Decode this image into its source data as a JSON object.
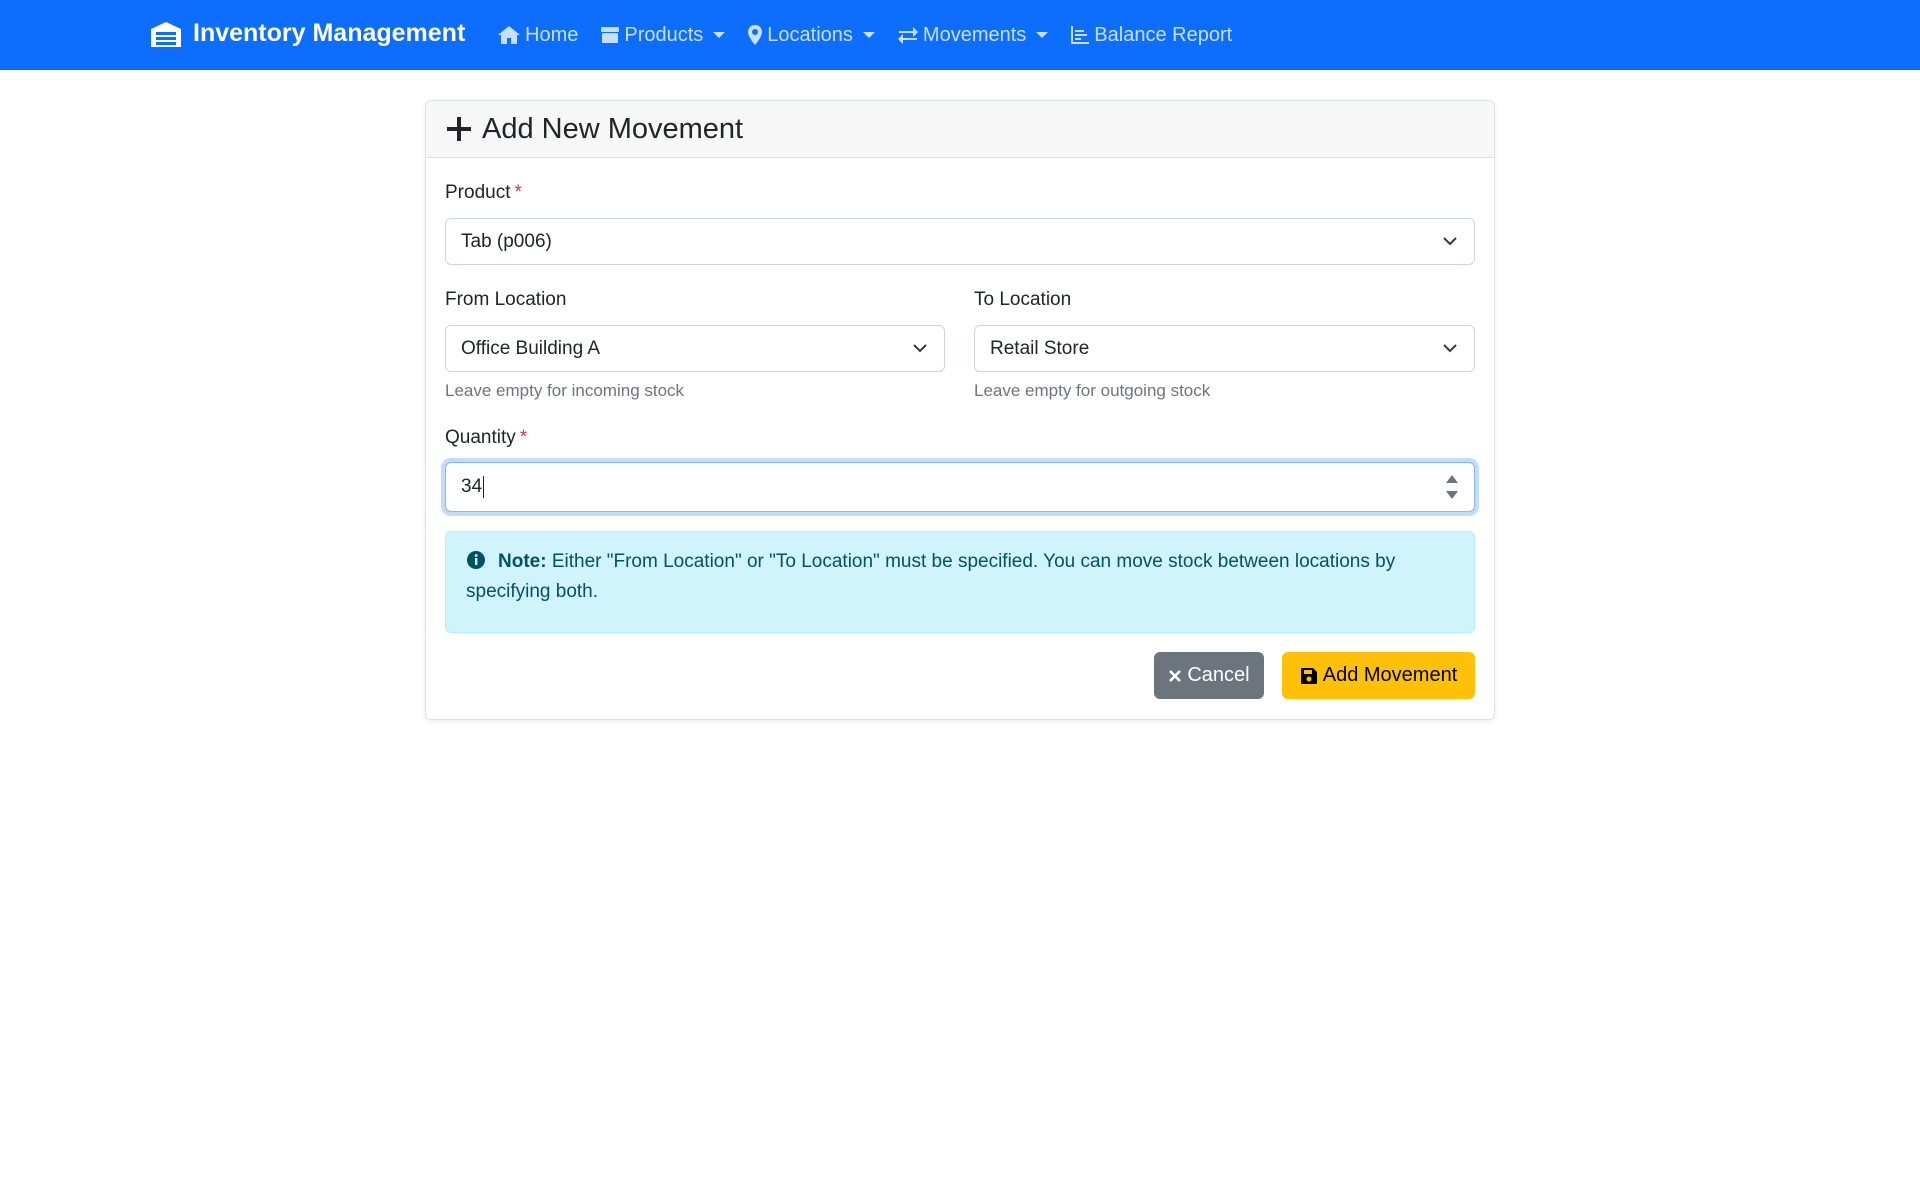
{
  "navbar": {
    "brand": "Inventory Management",
    "brand_icon": "warehouse-icon",
    "items": [
      {
        "label": "Home",
        "icon": "home-icon",
        "dropdown": false
      },
      {
        "label": "Products",
        "icon": "box-icon",
        "dropdown": true
      },
      {
        "label": "Locations",
        "icon": "map-marker-icon",
        "dropdown": true
      },
      {
        "label": "Movements",
        "icon": "exchange-icon",
        "dropdown": true
      },
      {
        "label": "Balance Report",
        "icon": "chart-icon",
        "dropdown": false
      }
    ],
    "bg_color": "#0d6efd"
  },
  "form": {
    "title": "Add New Movement",
    "product": {
      "label": "Product",
      "required_mark": "*",
      "value": "Tab (p006)"
    },
    "from_location": {
      "label": "From Location",
      "value": "Office Building A",
      "help": "Leave empty for incoming stock"
    },
    "to_location": {
      "label": "To Location",
      "value": "Retail Store",
      "help": "Leave empty for outgoing stock"
    },
    "quantity": {
      "label": "Quantity",
      "required_mark": "*",
      "value": "34"
    },
    "note": {
      "strong": "Note:",
      "text": " Either \"From Location\" or \"To Location\" must be specified. You can move stock between locations by specifying both."
    },
    "buttons": {
      "cancel": "Cancel",
      "submit": "Add Movement"
    }
  },
  "colors": {
    "primary": "#0d6efd",
    "warning": "#ffc107",
    "secondary": "#6c757d",
    "info_bg": "#cff4fc",
    "required": "#dc3545"
  }
}
